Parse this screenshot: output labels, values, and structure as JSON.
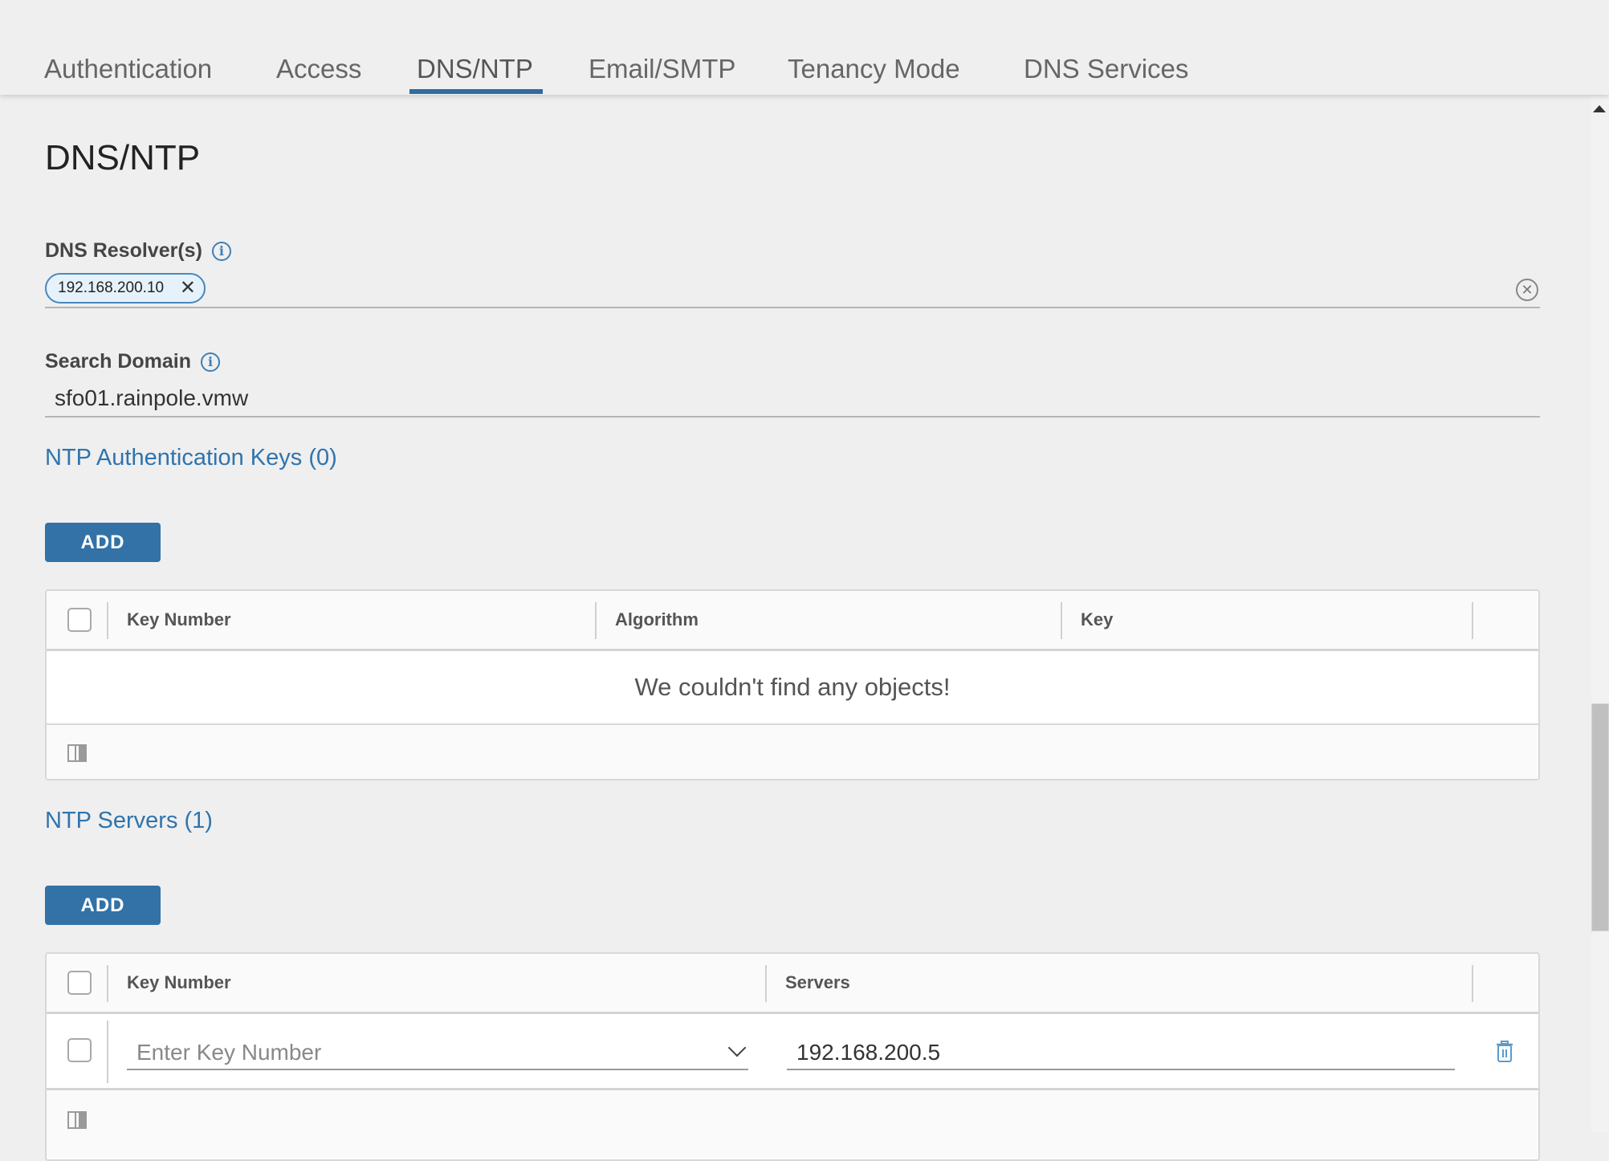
{
  "tabs": [
    {
      "label": "Authentication",
      "active": false
    },
    {
      "label": "Access",
      "active": false
    },
    {
      "label": "DNS/NTP",
      "active": true
    },
    {
      "label": "Email/SMTP",
      "active": false
    },
    {
      "label": "Tenancy Mode",
      "active": false
    },
    {
      "label": "DNS Services",
      "active": false
    }
  ],
  "page": {
    "title": "DNS/NTP"
  },
  "dns_resolvers": {
    "label": "DNS Resolver(s)",
    "info_icon": "info-icon",
    "chips": [
      "192.168.200.10"
    ],
    "chip_remove_glyph": "✕",
    "clear_glyph": "✕"
  },
  "search_domain": {
    "label": "Search Domain",
    "info_icon": "info-icon",
    "value": "sfo01.rainpole.vmw"
  },
  "ntp_auth_keys": {
    "title": "NTP Authentication Keys (0)",
    "add_label": "ADD",
    "columns": [
      "Key Number",
      "Algorithm",
      "Key"
    ],
    "empty_message": "We couldn't find any objects!",
    "rows": []
  },
  "ntp_servers": {
    "title": "NTP Servers (1)",
    "add_label": "ADD",
    "columns": [
      "Key Number",
      "Servers"
    ],
    "rows": [
      {
        "key_number": "",
        "key_number_placeholder": "Enter Key Number",
        "server": "192.168.200.5"
      }
    ]
  },
  "colors": {
    "accent": "#2f6c9e",
    "link": "#2f74ad",
    "button": "#3272a6",
    "chip_bg": "#e6f2fb"
  }
}
